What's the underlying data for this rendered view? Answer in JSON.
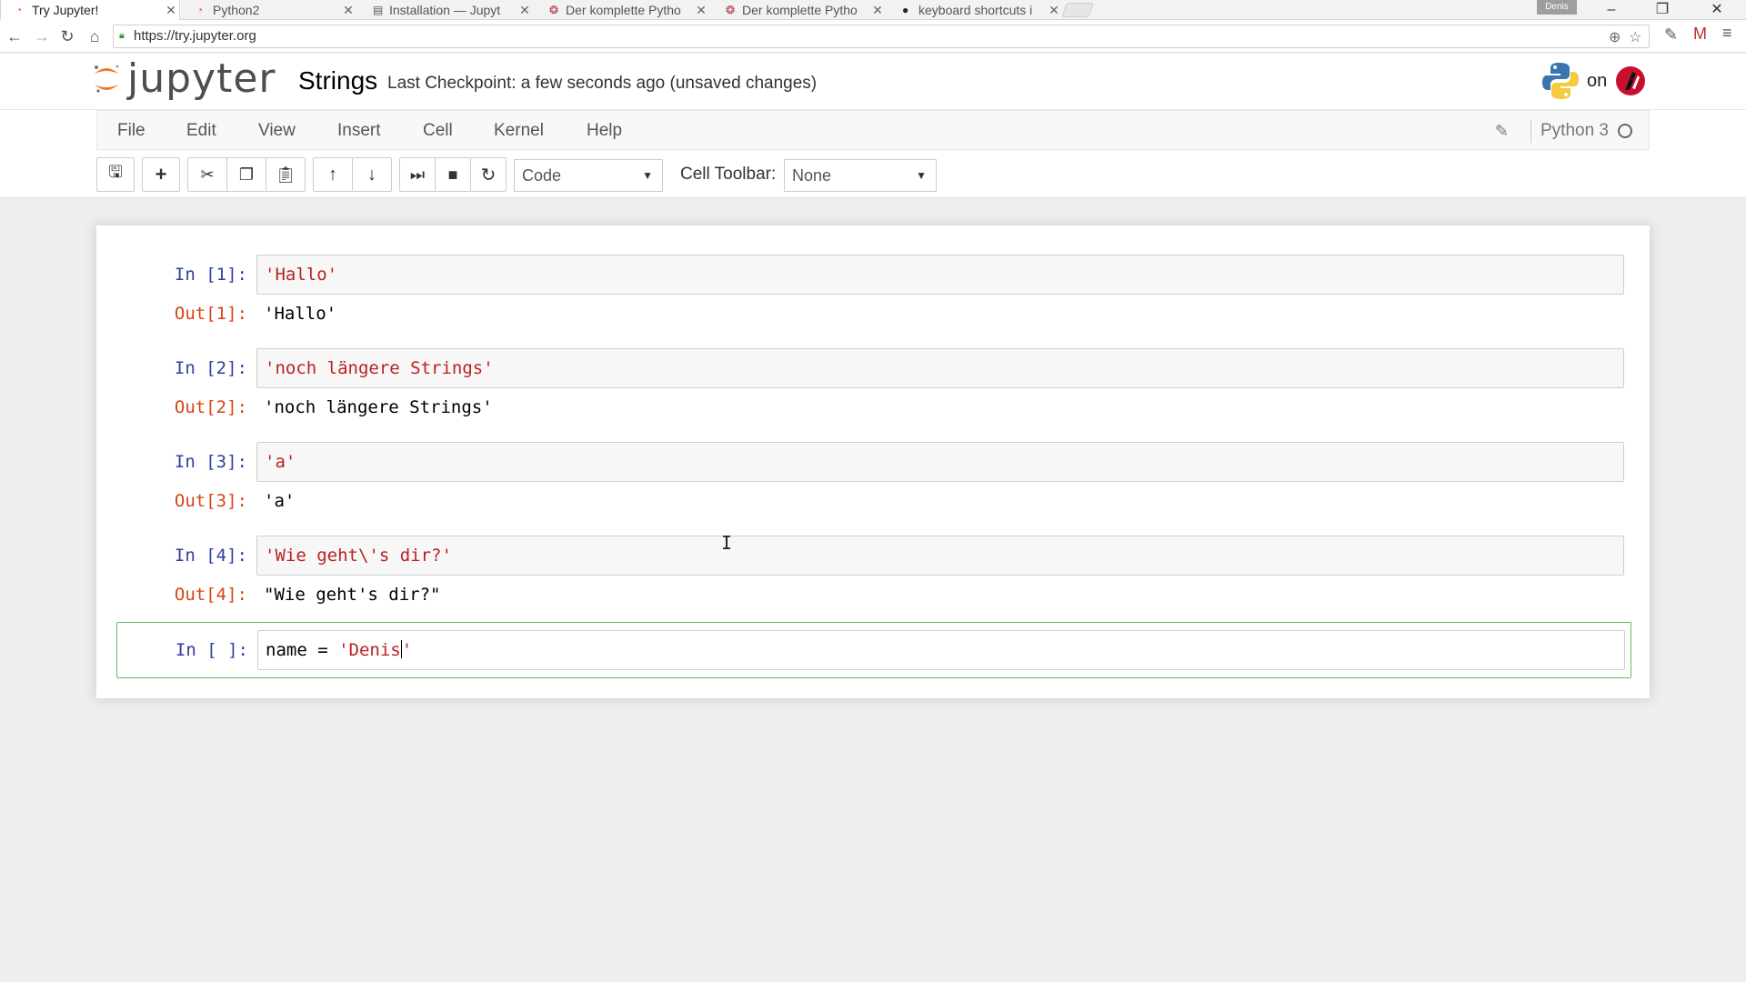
{
  "browser": {
    "tabs": [
      {
        "label": "Try Jupyter!",
        "active": true
      },
      {
        "label": "Python2",
        "active": false
      },
      {
        "label": "Installation — Jupyt",
        "active": false
      },
      {
        "label": "Der komplette Pytho",
        "active": false
      },
      {
        "label": "Der komplette Pytho",
        "active": false
      },
      {
        "label": "keyboard shortcuts i",
        "active": false
      }
    ],
    "user_badge": "Denis",
    "url": "https://try.jupyter.org"
  },
  "jupyter": {
    "logo_text": "jupyter",
    "notebook_name": "Strings",
    "checkpoint": "Last Checkpoint: a few seconds ago (unsaved changes)",
    "python_on": "on",
    "menus": [
      "File",
      "Edit",
      "View",
      "Insert",
      "Cell",
      "Kernel",
      "Help"
    ],
    "kernel_name": "Python 3",
    "cell_type": "Code",
    "cell_toolbar_label": "Cell Toolbar:",
    "cell_toolbar_value": "None"
  },
  "cells": [
    {
      "in_prompt": "In [1]:",
      "input": "'Hallo'",
      "out_prompt": "Out[1]:",
      "output": "'Hallo'"
    },
    {
      "in_prompt": "In [2]:",
      "input": "'noch längere Strings'",
      "out_prompt": "Out[2]:",
      "output": "'noch längere Strings'"
    },
    {
      "in_prompt": "In [3]:",
      "input": "'a'",
      "out_prompt": "Out[3]:",
      "output": "'a'"
    },
    {
      "in_prompt": "In [4]:",
      "input": "'Wie geht\\'s dir?'",
      "out_prompt": "Out[4]:",
      "output": "\"Wie geht's dir?\""
    },
    {
      "in_prompt": "In [ ]:",
      "input_plain": "name = ",
      "input_str": "'Denis",
      "input_after": "'"
    }
  ],
  "colors": {
    "in_prompt": "#303f9f",
    "out_prompt": "#d84315",
    "string": "#ba2121",
    "selected_border": "#66bb6a"
  }
}
